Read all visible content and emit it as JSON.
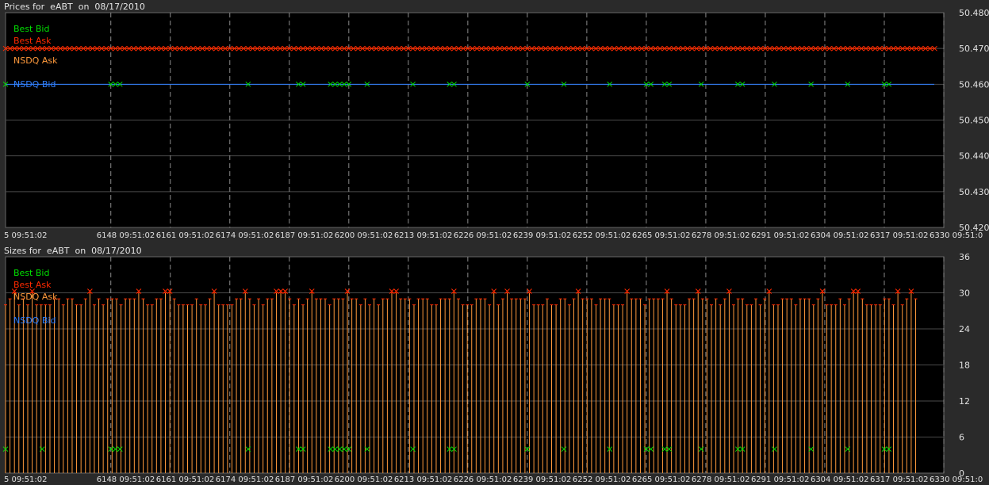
{
  "colors": {
    "best_bid": "#00e000",
    "best_ask": "#ff2a00",
    "nsdq_ask": "#ff9a3c",
    "nsdq_bid": "#2f7fff",
    "background": "#000000",
    "grid": "#4a4a4a"
  },
  "chart_data": [
    {
      "type": "line",
      "panel": "prices",
      "title": "Prices for  eABT  on  08/17/2010",
      "legend": [
        "Best Bid",
        "Best Ask",
        "NSDQ Ask",
        "NSDQ Bid"
      ],
      "ylim": [
        50.42,
        50.48
      ],
      "y_ticks": [
        "50.480",
        "50.470",
        "50.460",
        "50.450",
        "50.440",
        "50.430",
        "50.420"
      ],
      "x_ticks": [
        "5 09:51:02",
        "6148 09:51:02",
        "6161 09:51:02",
        "6174 09:51:02",
        "6187 09:51:02",
        "6200 09:51:02",
        "6213 09:51:02",
        "6226 09:51:02",
        "6239 09:51:02",
        "6252 09:51:02",
        "6265 09:51:02",
        "6278 09:51:02",
        "6291 09:51:02",
        "6304 09:51:02",
        "6317 09:51:02",
        "6330 09:51:0"
      ],
      "xlim": [
        6135,
        6340
      ],
      "series": [
        {
          "name": "Best Ask",
          "constant": 50.47,
          "marker": "x"
        },
        {
          "name": "NSDQ Ask",
          "constant": 50.47
        },
        {
          "name": "NSDQ Bid",
          "constant": 50.46
        },
        {
          "name": "Best Bid",
          "value": 50.46,
          "x": [
            6135,
            6158,
            6159,
            6160,
            6188,
            6199,
            6200,
            6206,
            6207,
            6208,
            6209,
            6210,
            6214,
            6224,
            6232,
            6233,
            6249,
            6257,
            6267,
            6275,
            6276,
            6279,
            6280,
            6287,
            6295,
            6296,
            6303,
            6311,
            6319,
            6327,
            6328
          ]
        }
      ],
      "grid": true
    },
    {
      "type": "bar",
      "panel": "sizes",
      "title": "Sizes for  eABT  on  08/17/2010",
      "legend": [
        "Best Bid",
        "Best Ask",
        "NSDQ Ask",
        "NSDQ Bid"
      ],
      "ylim": [
        0,
        36
      ],
      "y_ticks": [
        "36",
        "30",
        "24",
        "18",
        "12",
        "6",
        "0"
      ],
      "x_ticks": [
        "5 09:51:02",
        "6148 09:51:02",
        "6161 09:51:02",
        "6174 09:51:02",
        "6187 09:51:02",
        "6200 09:51:02",
        "6213 09:51:02",
        "6226 09:51:02",
        "6239 09:51:02",
        "6252 09:51:02",
        "6265 09:51:02",
        "6278 09:51:02",
        "6291 09:51:02",
        "6304 09:51:02",
        "6317 09:51:02",
        "6330 09:51:0"
      ],
      "xlim": [
        6135,
        6340
      ],
      "series": [
        {
          "name": "NSDQ Ask",
          "x_start": 6135,
          "x_step": 1,
          "values": [
            28,
            29,
            30,
            28,
            29,
            28,
            30,
            28,
            28,
            28,
            28,
            29,
            29,
            28,
            29,
            29,
            28,
            28,
            29,
            30,
            28,
            29,
            28,
            29,
            29,
            29,
            28,
            29,
            29,
            29,
            30,
            29,
            28,
            28,
            29,
            29,
            30,
            30,
            29,
            28,
            28,
            28,
            28,
            29,
            28,
            28,
            29,
            30,
            28,
            28,
            28,
            28,
            29,
            29,
            30,
            29,
            28,
            29,
            28,
            29,
            29,
            30,
            30,
            30,
            29,
            28,
            29,
            28,
            29,
            30,
            29,
            29,
            29,
            28,
            29,
            29,
            29,
            30,
            29,
            29,
            28,
            29,
            28,
            29,
            28,
            29,
            29,
            30,
            30,
            29,
            29,
            29,
            28,
            29,
            29,
            29,
            28,
            28,
            29,
            29,
            29,
            30,
            29,
            28,
            28,
            28,
            29,
            29,
            29,
            28,
            30,
            28,
            29,
            30,
            29,
            29,
            29,
            29,
            30,
            28,
            28,
            28,
            29,
            28,
            28,
            29,
            29,
            28,
            29,
            30,
            29,
            29,
            29,
            28,
            29,
            29,
            29,
            28,
            28,
            28,
            30,
            29,
            29,
            29,
            28,
            29,
            29,
            29,
            29,
            30,
            29,
            28,
            28,
            28,
            29,
            29,
            30,
            29,
            29,
            28,
            29,
            28,
            29,
            30,
            28,
            29,
            29,
            28,
            28,
            29,
            28,
            29,
            30,
            28,
            28,
            29,
            29,
            29,
            28,
            29,
            29,
            29,
            28,
            29,
            30,
            28,
            28,
            28,
            29,
            28,
            29,
            30,
            30,
            29,
            28,
            28,
            28,
            28,
            29,
            29,
            28,
            30,
            28,
            29,
            30,
            29
          ]
        },
        {
          "name": "Best Bid",
          "value": 4,
          "x": [
            6135,
            6143,
            6158,
            6159,
            6160,
            6188,
            6199,
            6200,
            6206,
            6207,
            6208,
            6209,
            6210,
            6214,
            6224,
            6232,
            6233,
            6249,
            6257,
            6267,
            6275,
            6276,
            6279,
            6280,
            6287,
            6295,
            6296,
            6303,
            6311,
            6319,
            6327,
            6328
          ]
        }
      ],
      "grid": true
    }
  ]
}
